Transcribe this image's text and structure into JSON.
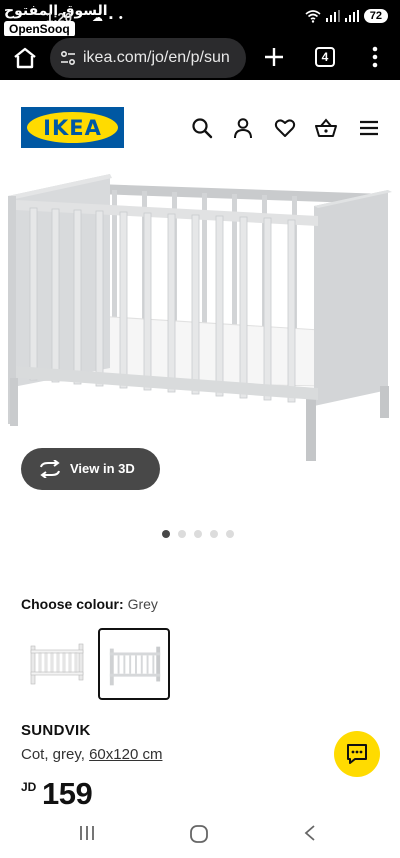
{
  "status_bar": {
    "time": "1:20",
    "watermark_arabic": "السوق المفتوح",
    "watermark_brand": "OpenSooq",
    "battery": "72"
  },
  "browser": {
    "url": "ikea.com/jo/en/p/sun",
    "tab_count": "4"
  },
  "header": {
    "logo_text": "IKEA"
  },
  "product": {
    "view_3d_label": "View in 3D",
    "gallery_dots": 5,
    "gallery_active_index": 0,
    "colour_label": "Choose colour:",
    "colour_value": "Grey",
    "name": "SUNDVIK",
    "desc_prefix": "Cot, grey, ",
    "desc_dimension": "60x120 cm",
    "currency": "JD",
    "price": "159"
  },
  "colors": {
    "ikea_blue": "#0058a3",
    "ikea_yellow": "#ffdb00",
    "view3d_bg": "#484848"
  }
}
